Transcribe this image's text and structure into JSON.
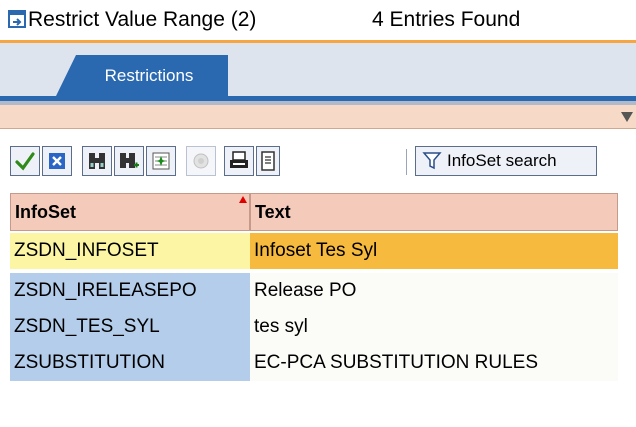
{
  "window": {
    "title": "Restrict Value Range (2)",
    "entries_found": "4 Entries Found"
  },
  "tabs": [
    {
      "label": "Restrictions",
      "active": true
    }
  ],
  "toolbar": {
    "buttons": [
      {
        "icon": "check-icon",
        "name": "continue"
      },
      {
        "icon": "cancel-icon",
        "name": "cancel"
      },
      {
        "icon": "binoculars-icon",
        "name": "find"
      },
      {
        "icon": "binoculars-plus-icon",
        "name": "find-next"
      },
      {
        "icon": "new-list-icon",
        "name": "new-list"
      },
      {
        "icon": "disabled-help-icon",
        "name": "disabled-function"
      },
      {
        "icon": "print-icon",
        "name": "print"
      },
      {
        "icon": "info-page-icon",
        "name": "info"
      }
    ],
    "infoset_search_label": "InfoSet search"
  },
  "table": {
    "columns": [
      "InfoSet",
      "Text"
    ],
    "rows": [
      {
        "infoset": "ZSDN_INFOSET",
        "text": "Infoset Tes Syl",
        "selected": true
      },
      {
        "infoset": "ZSDN_IRELEASEPO",
        "text": "Release PO",
        "selected": false
      },
      {
        "infoset": "ZSDN_TES_SYL",
        "text": "tes syl",
        "selected": false
      },
      {
        "infoset": "ZSUBSTITUTION",
        "text": "EC-PCA SUBSTITUTION RULES",
        "selected": false
      }
    ]
  },
  "colors": {
    "title_underline": "#f7a541",
    "tab_blue": "#2a68b0",
    "header_bg": "#f4cbbb",
    "key_column_bg": "#b3cdea",
    "selected_key_bg": "#fbf5a4",
    "selected_text_bg": "#f6bb3e"
  }
}
